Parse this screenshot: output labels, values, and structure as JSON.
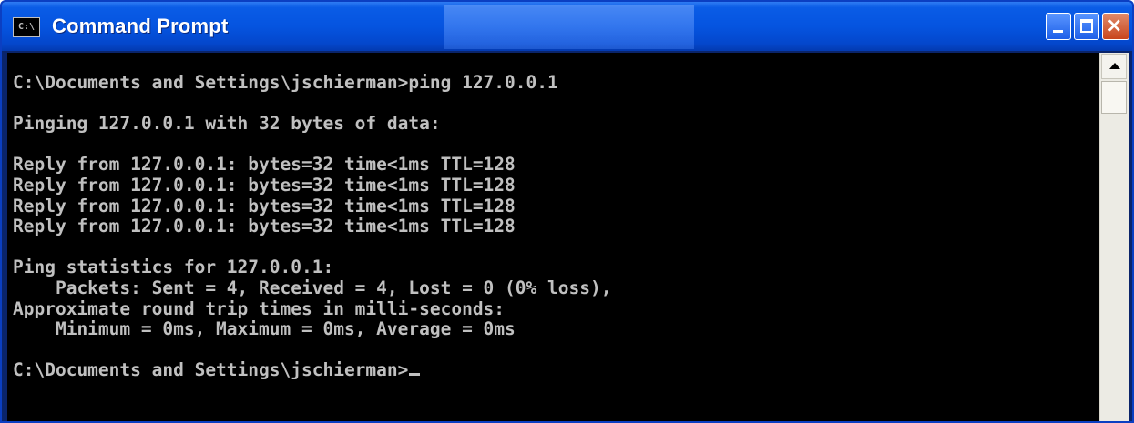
{
  "window": {
    "title": "Command Prompt",
    "icon_name": "console-icon",
    "icon_text": "C:\\",
    "controls": {
      "minimize": "minimize-icon",
      "maximize": "maximize-icon",
      "close": "close-icon",
      "close_glyph": "×"
    }
  },
  "console": {
    "text": "C:\\Documents and Settings\\jschierman>ping 127.0.0.1\n\nPinging 127.0.0.1 with 32 bytes of data:\n\nReply from 127.0.0.1: bytes=32 time<1ms TTL=128\nReply from 127.0.0.1: bytes=32 time<1ms TTL=128\nReply from 127.0.0.1: bytes=32 time<1ms TTL=128\nReply from 127.0.0.1: bytes=32 time<1ms TTL=128\n\nPing statistics for 127.0.0.1:\n    Packets: Sent = 4, Received = 4, Lost = 0 (0% loss),\nApproximate round trip times in milli-seconds:\n    Minimum = 0ms, Maximum = 0ms, Average = 0ms\n\nC:\\Documents and Settings\\jschierman>",
    "text_color": "#c0c0c0",
    "background": "#000000"
  },
  "scrollbar": {
    "up_arrow": "up-arrow-icon"
  }
}
